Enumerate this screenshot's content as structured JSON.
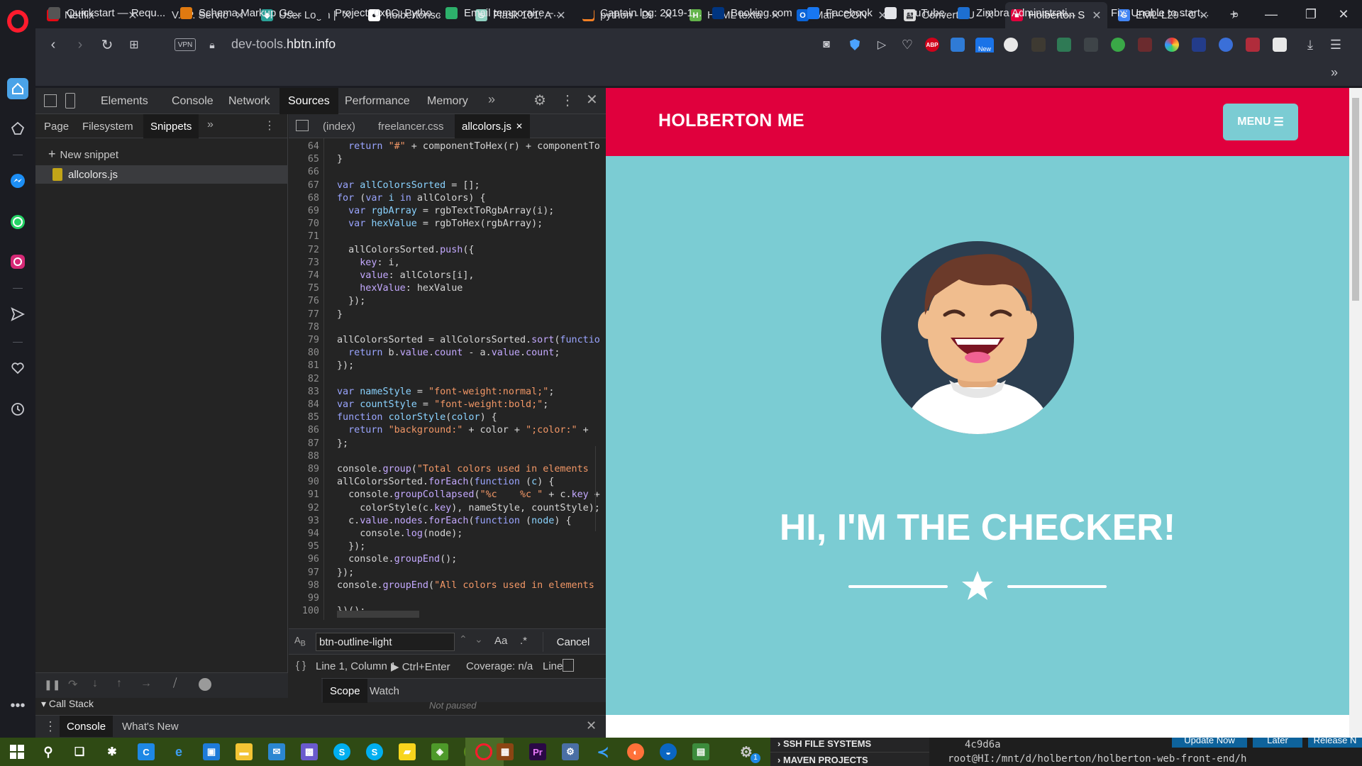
{
  "tabs": [
    {
      "title": "Netflix",
      "icon": "netflix-icon",
      "color": "#e50914",
      "glyph": "N"
    },
    {
      "title": "V.I.P. Servic",
      "icon": "blank-icon",
      "color": "#1b1c22",
      "glyph": ""
    },
    {
      "title": "User Login |",
      "icon": "gitlab-icon",
      "color": "#2aa198",
      "glyph": "◆"
    },
    {
      "title": "holbertonsc",
      "icon": "github-icon",
      "color": "#ffffff",
      "glyph": "●"
    },
    {
      "title": "Flask 101: A",
      "icon": "flask-icon",
      "color": "#8fd0c0",
      "glyph": "♨"
    },
    {
      "title": "python - Di",
      "icon": "stackoverflow-icon",
      "color": "#f48024",
      "glyph": "≡"
    },
    {
      "title": "HTML texta",
      "icon": "html-icon",
      "color": "#63b34a",
      "glyph": "H"
    },
    {
      "title": "Mail - CON",
      "icon": "outlook-icon",
      "color": "#0a64d8",
      "glyph": "O"
    },
    {
      "title": "Convert cU",
      "icon": "document-icon",
      "color": "#dcdcdc",
      "glyph": "▤"
    },
    {
      "title": "Holberton S",
      "icon": "holberton-icon",
      "color": "#e0003d",
      "glyph": "■"
    },
    {
      "title": "EML-L29 - C",
      "icon": "google-icon",
      "color": "#4285f4",
      "glyph": "G"
    }
  ],
  "address": {
    "vpn_label": "VPN",
    "url_domain": "dev-tools.",
    "url_host": "hbtn.info",
    "abp_label": "ABP",
    "new_badge": "New"
  },
  "bookmarks": [
    {
      "label": "Quickstart — Requ...",
      "icon": "quickstart-icon",
      "color": "#555"
    },
    {
      "label": "Schema Markup Ge...",
      "icon": "schema-icon",
      "color": "#e07a10"
    },
    {
      "label": "Project: 0x0C. Pytho...",
      "icon": "holberton-icon",
      "color": "#1b1c22"
    },
    {
      "label": "Email temporaire –...",
      "icon": "email-icon",
      "color": "#2db06b"
    },
    {
      "label": "Captain log: 2019-1...",
      "icon": "holberton-icon",
      "color": "#1b1c22"
    },
    {
      "label": "Booking.com",
      "icon": "booking-icon",
      "color": "#003580"
    },
    {
      "label": "Facebook",
      "icon": "facebook-icon",
      "color": "#1877f2"
    },
    {
      "label": "YouTube",
      "icon": "document-icon",
      "color": "#e4e5e9"
    },
    {
      "label": "Zimbra Administrati...",
      "icon": "zimbra-icon",
      "color": "#1d6fd1"
    },
    {
      "label": "Fix: Unable to start...",
      "icon": "none",
      "color": "#2b2d35"
    }
  ],
  "devtools": {
    "panels": [
      "Elements",
      "Console",
      "Network",
      "Sources",
      "Performance",
      "Memory"
    ],
    "active_panel": "Sources",
    "navigator_tabs": [
      "Page",
      "Filesystem",
      "Snippets"
    ],
    "active_navigator": "Snippets",
    "new_snippet": "New snippet",
    "snippet_file": "allcolors.js",
    "editor_tabs": [
      "(index)",
      "freelancer.css",
      "allcolors.js"
    ],
    "active_editor_tab": "allcolors.js",
    "code": [
      {
        "n": "64",
        "html": "  <span class='kw'>return</span> <span class='str'>\"#\"</span> + componentToHex(r) + componentTo"
      },
      {
        "n": "65",
        "html": "}"
      },
      {
        "n": "66",
        "html": ""
      },
      {
        "n": "67",
        "html": "<span class='kw'>var</span> <span class='def'>allColorsSorted</span> = [];"
      },
      {
        "n": "68",
        "html": "<span class='kw'>for</span> (<span class='kw'>var</span> <span class='def'>i</span> <span class='kw'>in</span> allColors) {"
      },
      {
        "n": "69",
        "html": "  <span class='kw'>var</span> <span class='def'>rgbArray</span> = rgbTextToRgbArray(i);"
      },
      {
        "n": "70",
        "html": "  <span class='kw'>var</span> <span class='def'>hexValue</span> = rgbToHex(rgbArray);"
      },
      {
        "n": "71",
        "html": ""
      },
      {
        "n": "72",
        "html": "  allColorsSorted.<span class='prop'>push</span>({"
      },
      {
        "n": "73",
        "html": "    <span class='prop'>key</span>: i,"
      },
      {
        "n": "74",
        "html": "    <span class='prop'>value</span>: allColors[i],"
      },
      {
        "n": "75",
        "html": "    <span class='prop'>hexValue</span>: hexValue"
      },
      {
        "n": "76",
        "html": "  });"
      },
      {
        "n": "77",
        "html": "}"
      },
      {
        "n": "78",
        "html": ""
      },
      {
        "n": "79",
        "html": "allColorsSorted = allColorsSorted.<span class='prop'>sort</span>(<span class='kw'>functio</span>"
      },
      {
        "n": "80",
        "html": "  <span class='kw'>return</span> b.<span class='prop'>value</span>.<span class='prop'>count</span> - a.<span class='prop'>value</span>.<span class='prop'>count</span>;"
      },
      {
        "n": "81",
        "html": "});"
      },
      {
        "n": "82",
        "html": ""
      },
      {
        "n": "83",
        "html": "<span class='kw'>var</span> <span class='def'>nameStyle</span> = <span class='str'>\"font-weight:normal;\"</span>;"
      },
      {
        "n": "84",
        "html": "<span class='kw'>var</span> <span class='def'>countStyle</span> = <span class='str'>\"font-weight:bold;\"</span>;"
      },
      {
        "n": "85",
        "html": "<span class='kw'>function</span> <span class='def'>colorStyle</span>(<span class='def'>color</span>) {"
      },
      {
        "n": "86",
        "html": "  <span class='kw'>return</span> <span class='str'>\"background:\"</span> + color + <span class='str'>\";color:\"</span> +"
      },
      {
        "n": "87",
        "html": "};"
      },
      {
        "n": "88",
        "html": ""
      },
      {
        "n": "89",
        "html": "console.<span class='prop'>group</span>(<span class='str'>\"Total colors used in elements</span>"
      },
      {
        "n": "90",
        "html": "allColorsSorted.<span class='prop'>forEach</span>(<span class='kw'>function</span> (<span class='def'>c</span>) {"
      },
      {
        "n": "91",
        "html": "  console.<span class='prop'>groupCollapsed</span>(<span class='str'>\"%c    %c \"</span> + c.<span class='prop'>key</span> +"
      },
      {
        "n": "92",
        "html": "    colorStyle(c.<span class='prop'>key</span>), nameStyle, countStyle);"
      },
      {
        "n": "93",
        "html": "  c.<span class='prop'>value</span>.<span class='prop'>nodes</span>.<span class='prop'>forEach</span>(<span class='kw'>function</span> (<span class='def'>node</span>) {"
      },
      {
        "n": "94",
        "html": "    console.<span class='prop'>log</span>(node);"
      },
      {
        "n": "95",
        "html": "  });"
      },
      {
        "n": "96",
        "html": "  console.<span class='prop'>groupEnd</span>();"
      },
      {
        "n": "97",
        "html": "});"
      },
      {
        "n": "98",
        "html": "console.<span class='prop'>groupEnd</span>(<span class='str'>\"All colors used in elements</span>"
      },
      {
        "n": "99",
        "html": ""
      },
      {
        "n": "100",
        "html": "})();"
      }
    ],
    "search_value": "btn-outline-light",
    "match_case_label": "Aa",
    "regex_label": ".*",
    "cancel_label": "Cancel",
    "status_position": "Line 1, Column 1",
    "run_hint": "Ctrl+Enter",
    "coverage": "Coverage: n/a",
    "status_tail": "Line",
    "scope_tabs": [
      "Scope",
      "Watch"
    ],
    "not_paused": "Not paused",
    "call_stack": "Call Stack",
    "drawer_tabs": [
      "Console",
      "What's New"
    ]
  },
  "webpage": {
    "logo": "HOLBERTON ME",
    "menu_label": "MENU",
    "hero_title": "HI, I'M THE CHECKER!",
    "colors": {
      "header": "#e0003d",
      "body": "#7bccd3"
    }
  },
  "taskbar": {
    "vscode_items": [
      "SSH FILE SYSTEMS",
      "MAVEN PROJECTS"
    ],
    "terminal_lines": [
      "4c9d6a",
      "root@HI:/mnt/d/holberton/holberton-web-front-end/h"
    ],
    "update_buttons": [
      "Update Now",
      "Later",
      "Release N"
    ],
    "settings_badge": "1"
  }
}
